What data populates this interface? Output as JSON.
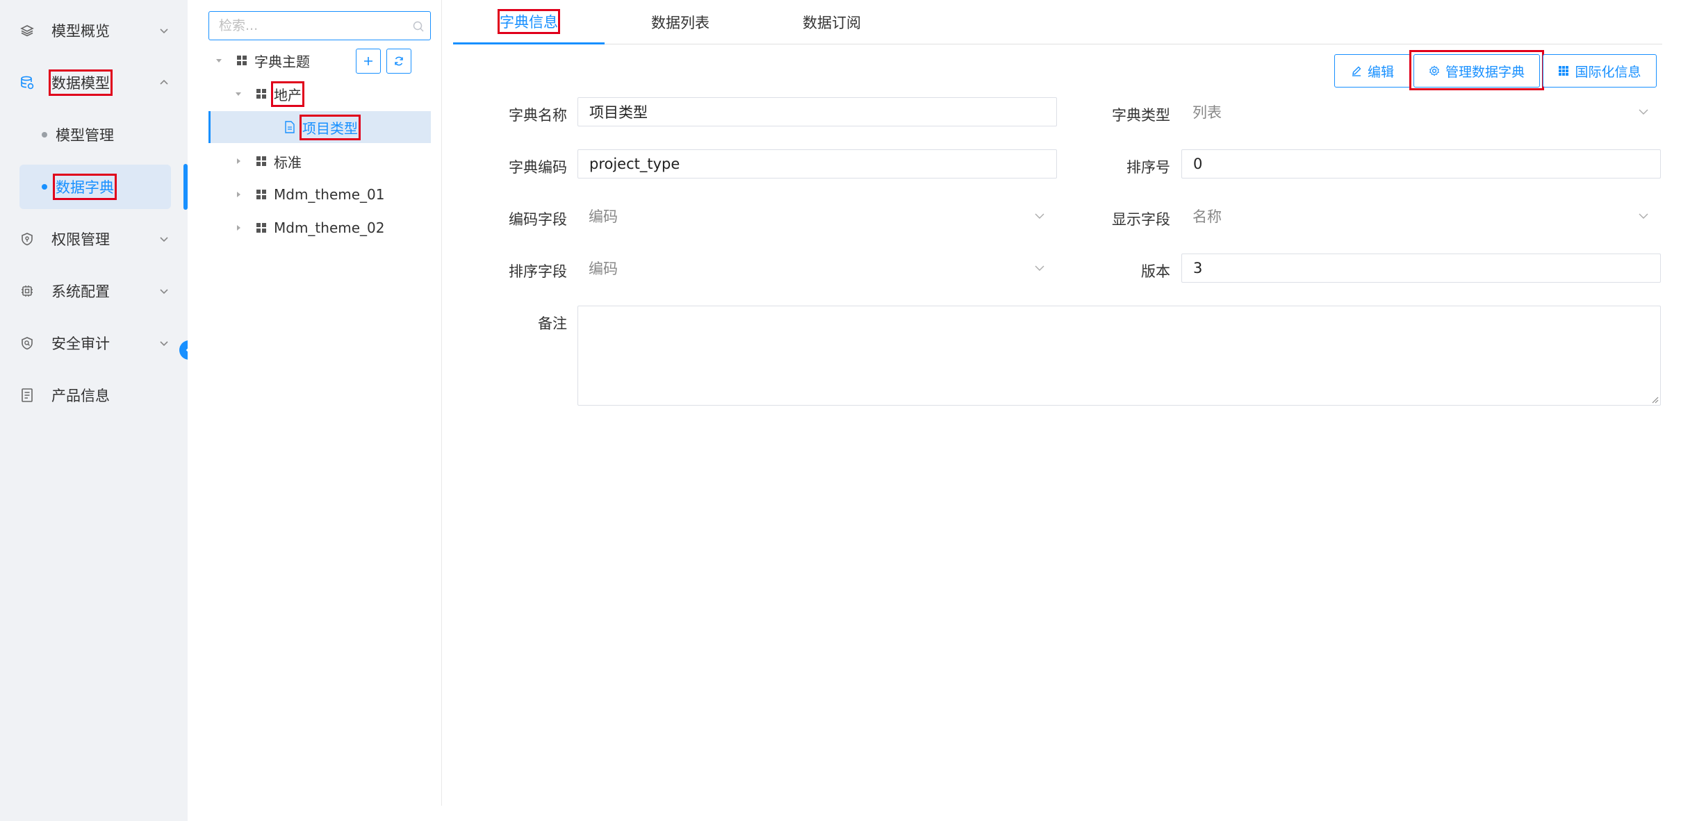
{
  "sidebar": {
    "items": [
      {
        "label": "模型概览",
        "icon": "layers-icon"
      },
      {
        "label": "数据模型",
        "icon": "database-icon"
      },
      {
        "label": "权限管理",
        "icon": "shield-icon"
      },
      {
        "label": "系统配置",
        "icon": "chip-icon"
      },
      {
        "label": "安全审计",
        "icon": "audit-shield-icon"
      },
      {
        "label": "产品信息",
        "icon": "document-icon"
      }
    ],
    "subitems": [
      {
        "label": "模型管理"
      },
      {
        "label": "数据字典"
      }
    ]
  },
  "tree": {
    "search_placeholder": "检索...",
    "nodes": [
      {
        "label": "字典主题"
      },
      {
        "label": "地产"
      },
      {
        "label": "项目类型"
      },
      {
        "label": "标准"
      },
      {
        "label": "Mdm_theme_01"
      },
      {
        "label": "Mdm_theme_02"
      }
    ]
  },
  "tabs": [
    {
      "label": "字典信息"
    },
    {
      "label": "数据列表"
    },
    {
      "label": "数据订阅"
    }
  ],
  "toolbar": {
    "edit": "编辑",
    "manage": "管理数据字典",
    "i18n": "国际化信息"
  },
  "form": {
    "dict_name_label": "字典名称",
    "dict_name_value": "项目类型",
    "dict_type_label": "字典类型",
    "dict_type_value": "列表",
    "dict_code_label": "字典编码",
    "dict_code_value": "project_type",
    "sort_no_label": "排序号",
    "sort_no_value": "0",
    "code_field_label": "编码字段",
    "code_field_value": "编码",
    "display_field_label": "显示字段",
    "display_field_value": "名称",
    "sort_field_label": "排序字段",
    "sort_field_value": "编码",
    "version_label": "版本",
    "version_value": "3",
    "remark_label": "备注",
    "remark_value": ""
  },
  "colors": {
    "accent": "#1890ff",
    "highlight": "#e0001b",
    "sidebar_bg": "#f0f2f5"
  }
}
